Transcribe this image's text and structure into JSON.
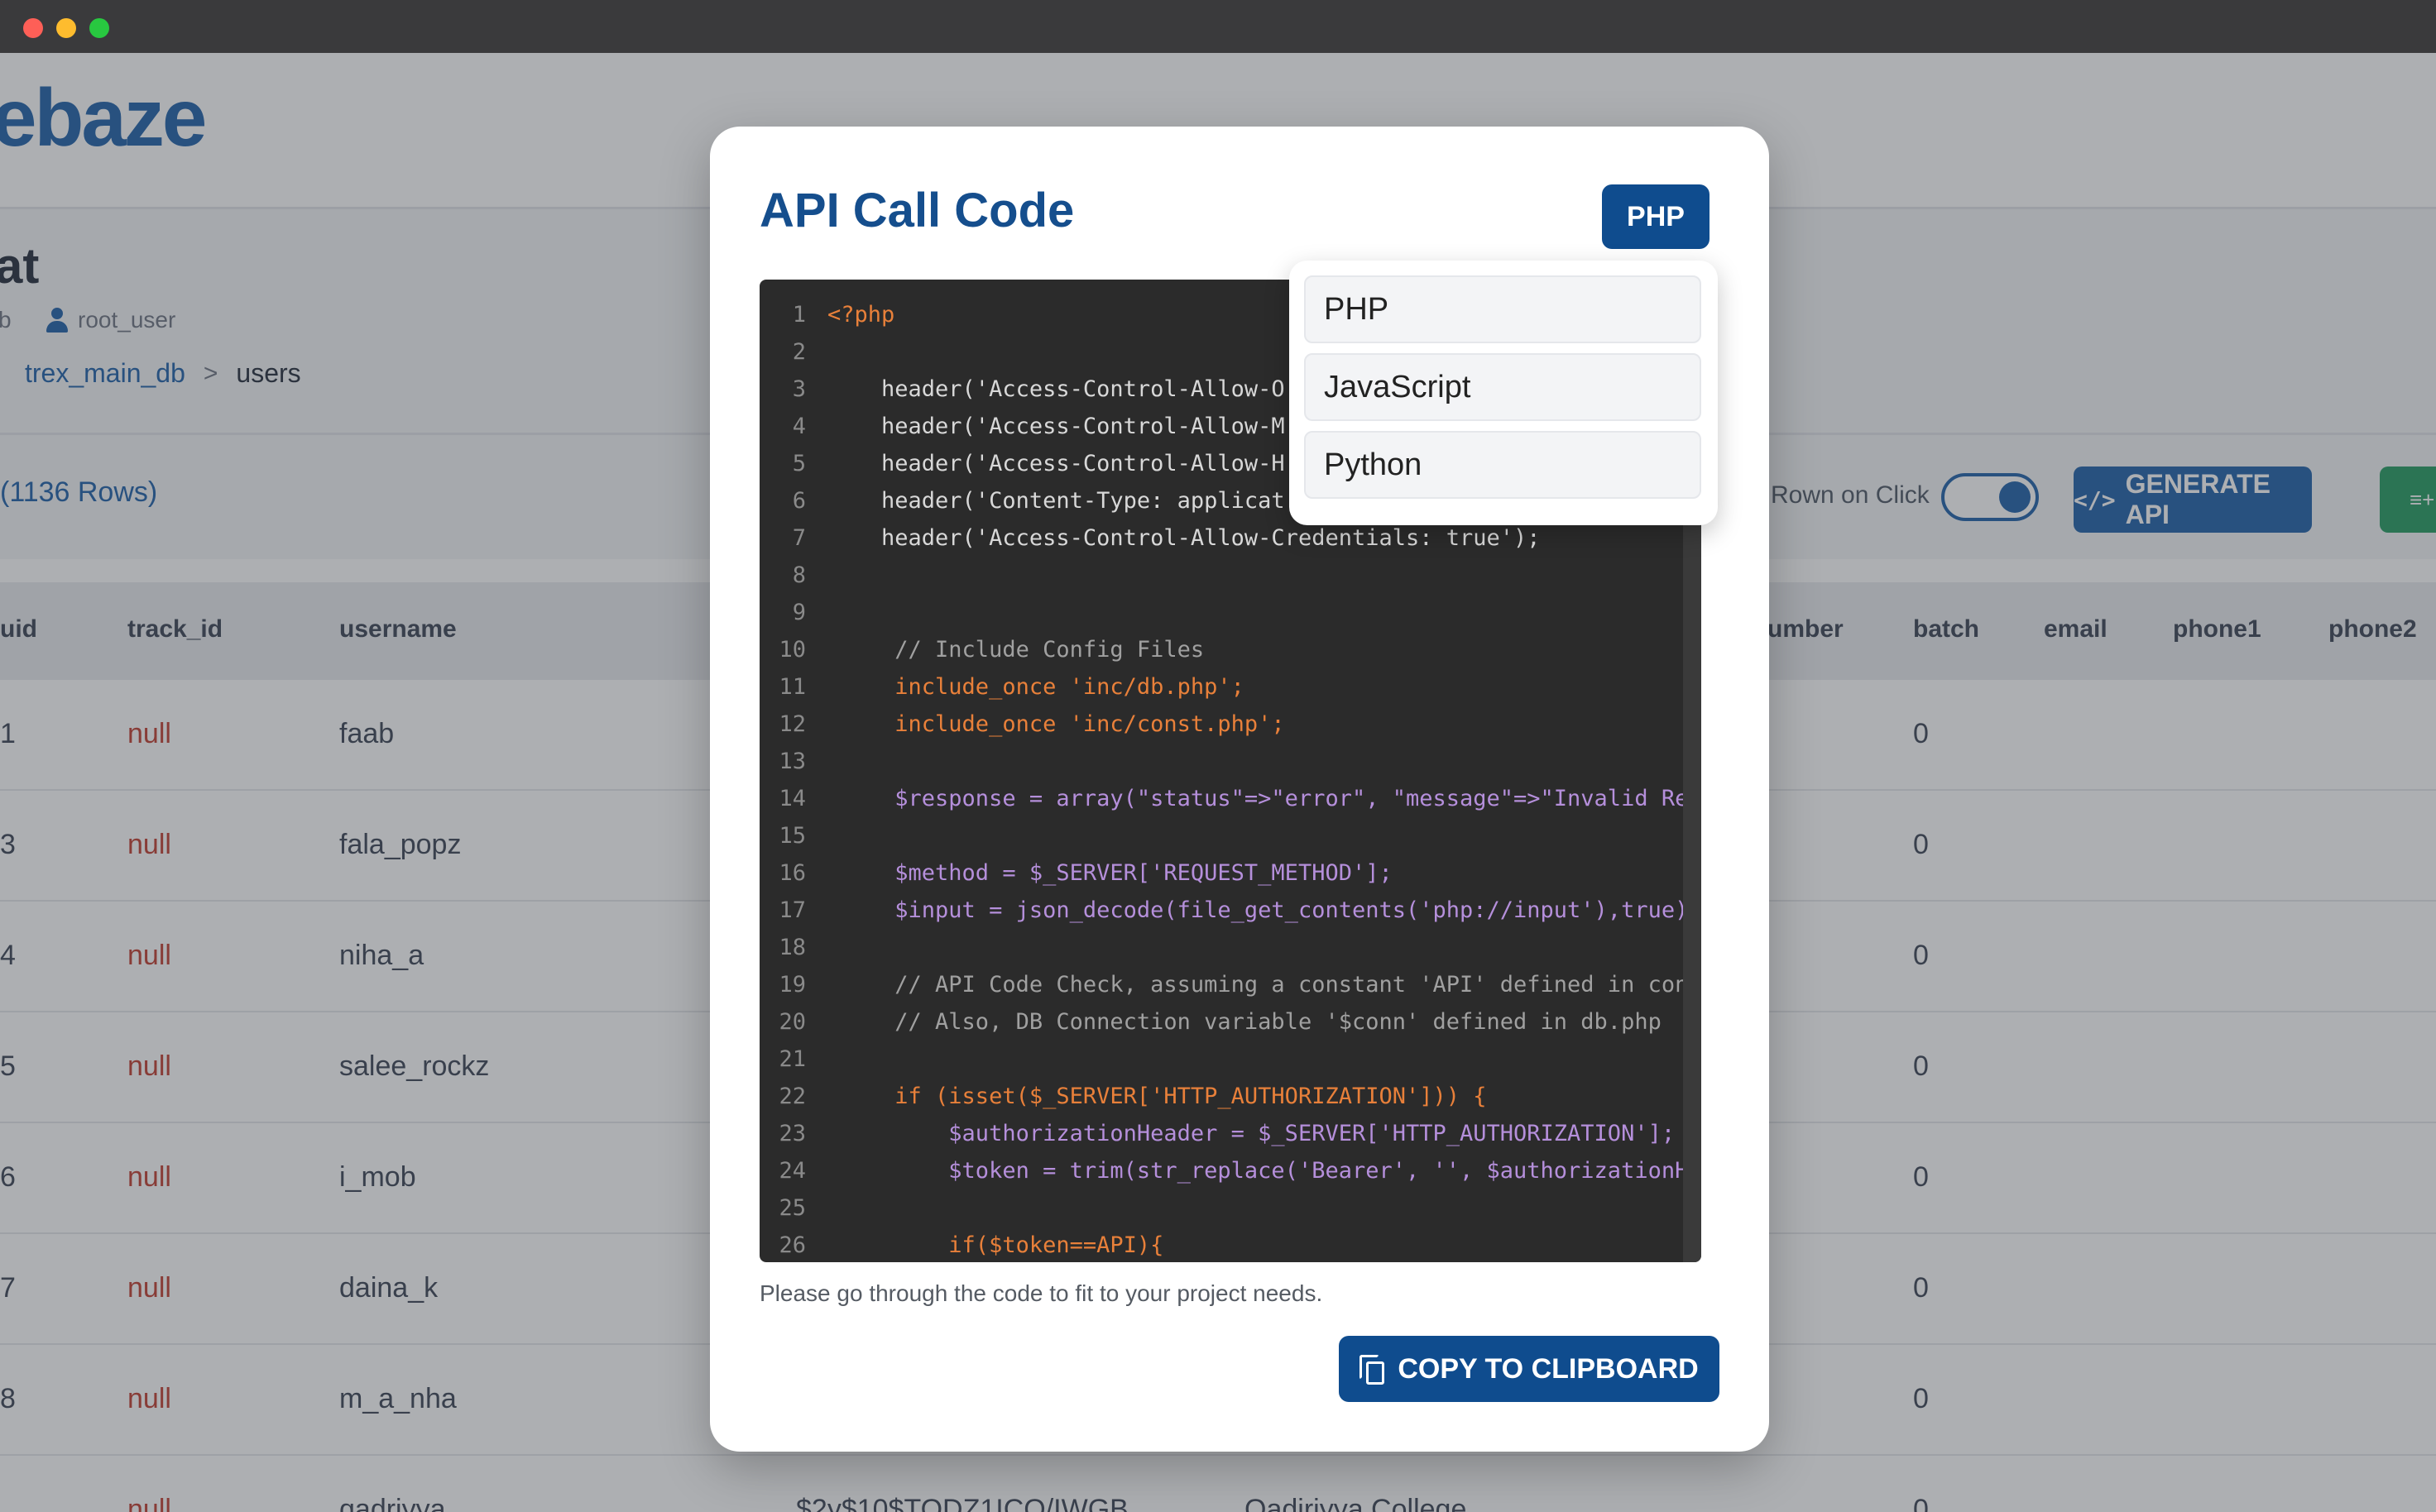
{
  "app": {
    "logo_text": "ebaze",
    "db_title": "at",
    "db_meta": "b",
    "db_user": "root_user",
    "breadcrumb": {
      "db": "trex_main_db",
      "separator": ">",
      "current": "users"
    },
    "rows_count": "(1136 Rows)",
    "toggle_label": "Rown on Click",
    "generate_api_label": "GENERATE API",
    "generate_api_icon": "code-icon",
    "green_button_icon": "≡+",
    "table": {
      "headers": [
        "uid",
        "track_id",
        "username",
        "umber",
        "batch",
        "email",
        "phone1",
        "phone2"
      ],
      "rows": [
        {
          "uid": "1",
          "track_id": "null",
          "username": "faab",
          "batch": "0"
        },
        {
          "uid": "3",
          "track_id": "null",
          "username": "fala_popz",
          "batch": "0"
        },
        {
          "uid": "4",
          "track_id": "null",
          "username": "niha_a",
          "batch": "0"
        },
        {
          "uid": "5",
          "track_id": "null",
          "username": "salee_rockz",
          "batch": "0"
        },
        {
          "uid": "6",
          "track_id": "null",
          "username": "i_mob",
          "batch": "0"
        },
        {
          "uid": "7",
          "track_id": "null",
          "username": "daina_k",
          "batch": "0"
        },
        {
          "uid": "8",
          "track_id": "null",
          "username": "m_a_nha",
          "batch": "0"
        },
        {
          "uid": "",
          "track_id": "null",
          "username": "qadriyya",
          "password": "$2y$10$TODZ1ICO/IWGB...",
          "college": "Qadiriyya College",
          "batch": "0"
        }
      ]
    }
  },
  "modal": {
    "title": "API Call Code",
    "language_button": "PHP",
    "dropdown_options": [
      "PHP",
      "JavaScript",
      "Python"
    ],
    "note": "Please go through the code to fit to your project needs.",
    "copy_button": "COPY TO CLIPBOARD",
    "copy_icon": "copy-icon",
    "code_lines": [
      {
        "n": "1",
        "text": "<?php"
      },
      {
        "n": "2",
        "text": ""
      },
      {
        "n": "3",
        "text": "    header('Access-Control-Allow-O"
      },
      {
        "n": "4",
        "text": "    header('Access-Control-Allow-M"
      },
      {
        "n": "5",
        "text": "    header('Access-Control-Allow-H"
      },
      {
        "n": "6",
        "text": "    header('Content-Type: applicat"
      },
      {
        "n": "7",
        "text": "    header('Access-Control-Allow-Credentials: true');"
      },
      {
        "n": "8",
        "text": ""
      },
      {
        "n": "9",
        "text": ""
      },
      {
        "n": "10",
        "text": "     // Include Config Files"
      },
      {
        "n": "11",
        "text": "     include_once 'inc/db.php';"
      },
      {
        "n": "12",
        "text": "     include_once 'inc/const.php';"
      },
      {
        "n": "13",
        "text": ""
      },
      {
        "n": "14",
        "text": "     $response = array(\"status\"=>\"error\", \"message\"=>\"Invalid Req"
      },
      {
        "n": "15",
        "text": ""
      },
      {
        "n": "16",
        "text": "     $method = $_SERVER['REQUEST_METHOD'];"
      },
      {
        "n": "17",
        "text": "     $input = json_decode(file_get_contents('php://input'),true);"
      },
      {
        "n": "18",
        "text": ""
      },
      {
        "n": "19",
        "text": "     // API Code Check, assuming a constant 'API' defined in cons"
      },
      {
        "n": "20",
        "text": "     // Also, DB Connection variable '$conn' defined in db.php"
      },
      {
        "n": "21",
        "text": ""
      },
      {
        "n": "22",
        "text": "     if (isset($_SERVER['HTTP_AUTHORIZATION'])) {"
      },
      {
        "n": "23",
        "text": "         $authorizationHeader = $_SERVER['HTTP_AUTHORIZATION'];"
      },
      {
        "n": "24",
        "text": "         $token = trim(str_replace('Bearer', '', $authorizationHe"
      },
      {
        "n": "25",
        "text": ""
      },
      {
        "n": "26",
        "text": "         if($token==API){"
      }
    ]
  }
}
